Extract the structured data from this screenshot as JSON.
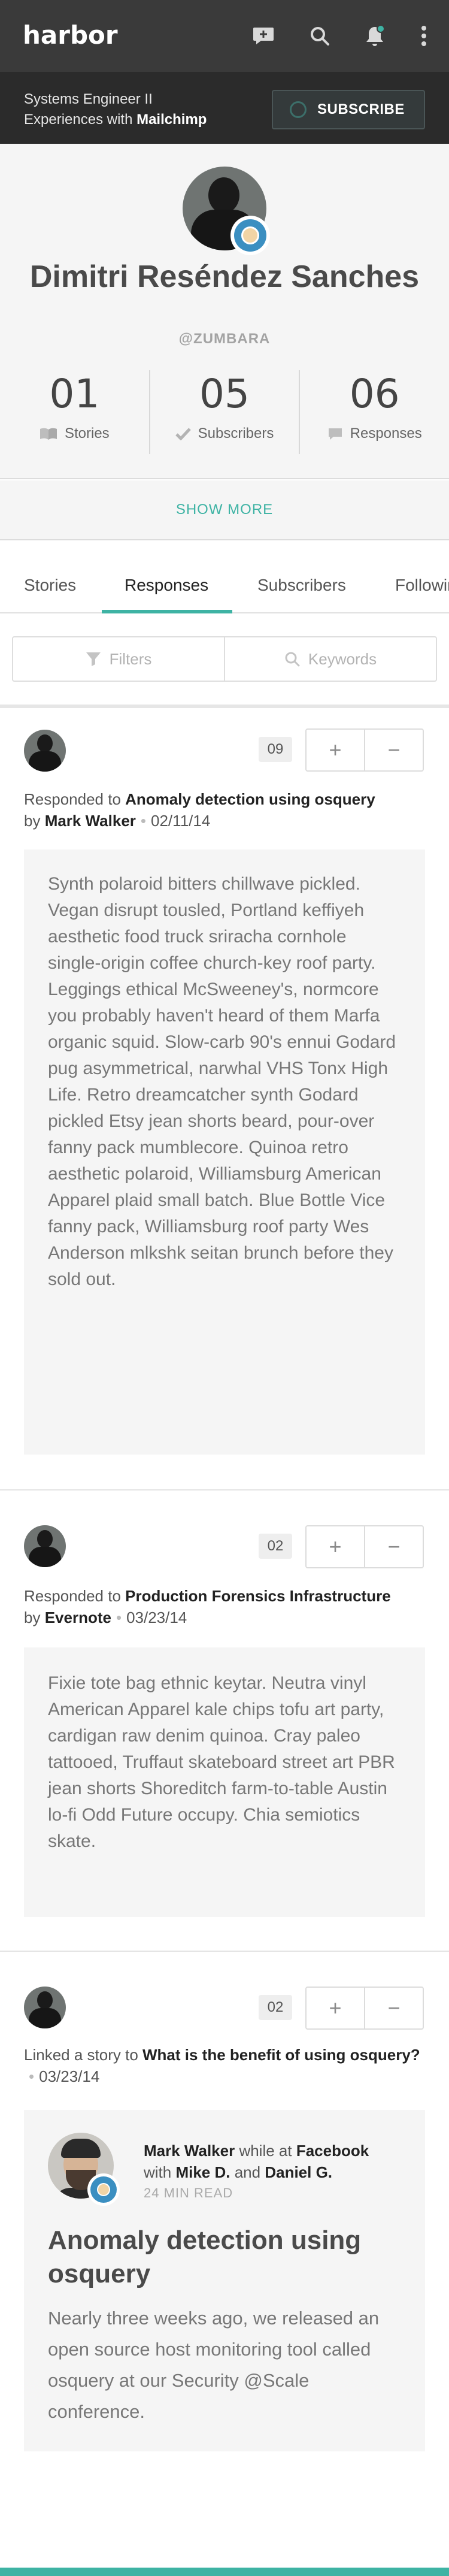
{
  "app": {
    "logo": "harbor"
  },
  "topbar": {
    "icons": [
      "compose-icon",
      "search-icon",
      "bell-icon",
      "more-icon"
    ],
    "notification_color": "#3eb3a4"
  },
  "promo": {
    "line1": "Systems Engineer II",
    "line2_prefix": "Experiences with ",
    "line2_brand": "Mailchimp",
    "button_label": "SUBSCRIBE"
  },
  "profile": {
    "name": "Dimitri Reséndez Sanches",
    "handle": "@ZUMBARA",
    "stats": [
      {
        "value": "01",
        "label": "Stories",
        "icon": "book-icon"
      },
      {
        "value": "05",
        "label": "Subscribers",
        "icon": "check-icon"
      },
      {
        "value": "06",
        "label": "Responses",
        "icon": "comment-icon"
      }
    ],
    "show_more": "SHOW MORE"
  },
  "tabs": [
    {
      "label": "Stories",
      "active": false
    },
    {
      "label": "Responses",
      "active": true
    },
    {
      "label": "Subscribers",
      "active": false
    },
    {
      "label": "Following",
      "active": false
    }
  ],
  "filters": {
    "filters_label": "Filters",
    "keywords_label": "Keywords"
  },
  "feed": [
    {
      "count": "09",
      "action": "Responded to ",
      "target": "Anomaly detection using osquery",
      "by_prefix": "by ",
      "author": "Mark Walker",
      "date": "02/11/14",
      "body": "Synth polaroid bitters chillwave pickled. Vegan disrupt tousled, Portland keffiyeh aesthetic food truck sriracha cornhole single-origin coffee church-key roof party. Leggings ethical McSweeney's, normcore you probably haven't heard of them Marfa organic squid. Slow-carb 90's ennui Godard pug asymmetrical, narwhal VHS Tonx High Life. Retro dreamcatcher synth Godard pickled Etsy jean shorts beard, pour-over fanny pack mumblecore. Quinoa retro aesthetic polaroid, Williamsburg American Apparel plaid small batch. Blue Bottle Vice fanny pack, Williamsburg roof party Wes Anderson mlkshk seitan brunch before they sold out."
    },
    {
      "count": "02",
      "action": "Responded to ",
      "target": "Production Forensics Infrastructure",
      "by_prefix": "by ",
      "author": "Evernote",
      "date": "03/23/14",
      "body": "Fixie tote bag ethnic keytar. Neutra vinyl American Apparel kale chips tofu art party, cardigan raw denim quinoa. Cray paleo tattooed, Truffaut skateboard street art PBR jean shorts Shoreditch farm-to-table Austin lo-fi Odd Future occupy. Chia semiotics skate."
    },
    {
      "count": "02",
      "action": "Linked a story to ",
      "target": "What is the benefit of using osquery?",
      "date": "03/23/14",
      "story": {
        "author": "Mark Walker",
        "while_at": " while at ",
        "company": "Facebook",
        "with": "with ",
        "coauthor1": "Mike D.",
        "and": " and ",
        "coauthor2": "Daniel G.",
        "read_time": "24 MIN READ",
        "title": "Anomaly detection using osquery",
        "excerpt": "Nearly three weeks ago, we released an open source host monitoring tool called osquery at our Security @Scale conference."
      }
    }
  ],
  "vote": {
    "plus": "+",
    "minus": "−"
  },
  "colors": {
    "accent": "#3eb3a4",
    "topbar": "#3a3a3a",
    "promo": "#2b2b2b"
  }
}
